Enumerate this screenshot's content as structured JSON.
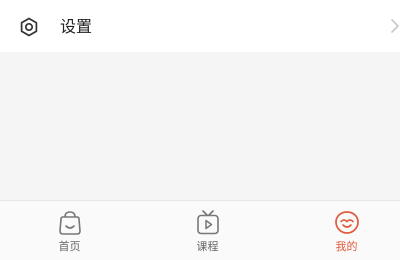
{
  "settings": {
    "label": "设置",
    "icon": "gear-icon"
  },
  "tabbar": {
    "active_color": "#e05a3b",
    "inactive_color": "#666666",
    "items": [
      {
        "label": "首页",
        "icon": "home-icon",
        "active": false
      },
      {
        "label": "课程",
        "icon": "tv-play-icon",
        "active": false
      },
      {
        "label": "我的",
        "icon": "profile-face-icon",
        "active": true
      }
    ]
  },
  "annotation_color": "#e8395a"
}
